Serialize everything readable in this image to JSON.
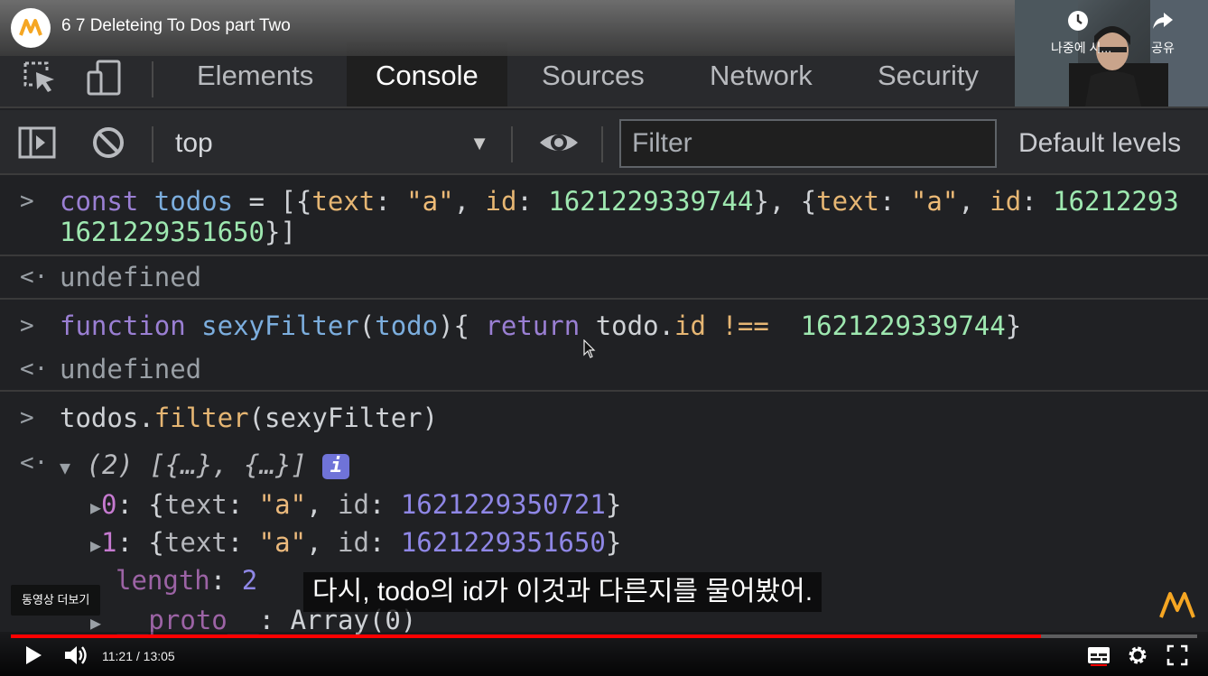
{
  "video": {
    "title": "6 7 Deleteing To Dos part Two",
    "watch_later_label": "나중에 시...",
    "share_label": "공유",
    "current_time": "11:21",
    "duration": "13:05",
    "time_display": "11:21 / 13:05",
    "progress_fraction": 0.868,
    "more_videos_label": "동영상 더보기",
    "subtitle": "다시, todo의 id가 이것과 다른지를 물어봤어.",
    "accent_color": "#ff0000",
    "brand_color": "#f5a623"
  },
  "devtools": {
    "tabs": [
      {
        "label": "Elements"
      },
      {
        "label": "Console",
        "active": true
      },
      {
        "label": "Sources"
      },
      {
        "label": "Network"
      },
      {
        "label": "Security"
      }
    ],
    "toolbar": {
      "context": "top",
      "filter_placeholder": "Filter",
      "levels": "Default levels"
    }
  },
  "console": {
    "cmd1": {
      "kw": "const",
      "var": "todos",
      "op": " = [{",
      "key1": "text",
      "str1": "\"a\"",
      "key2": "id",
      "num1": "1621229339744",
      "mid": "}, {",
      "key3": "text",
      "str2": "\"a\"",
      "key4": "id",
      "num2_cut": "16212293",
      "line2_num": "1621229351650",
      "line2_end": "}]"
    },
    "result1": "undefined",
    "cmd2": {
      "kw": "function",
      "name": "sexyFilter",
      "param": "todo",
      "ret": "return",
      "obj": "todo",
      "prop": "id",
      "op": "!==",
      "num": "1621229339744"
    },
    "result2": "undefined",
    "cmd3": {
      "obj": "todos",
      "method": "filter",
      "arg": "sexyFilter"
    },
    "result3": {
      "summary": "(2) [{…}, {…}]",
      "info": "i",
      "items": [
        {
          "index": "0",
          "text": "\"a\"",
          "id": "1621229350721"
        },
        {
          "index": "1",
          "text": "\"a\"",
          "id": "1621229351650"
        }
      ],
      "length_key": "length",
      "length_val": "2",
      "proto_key": "__proto__",
      "proto_val": "Array(0)"
    }
  }
}
